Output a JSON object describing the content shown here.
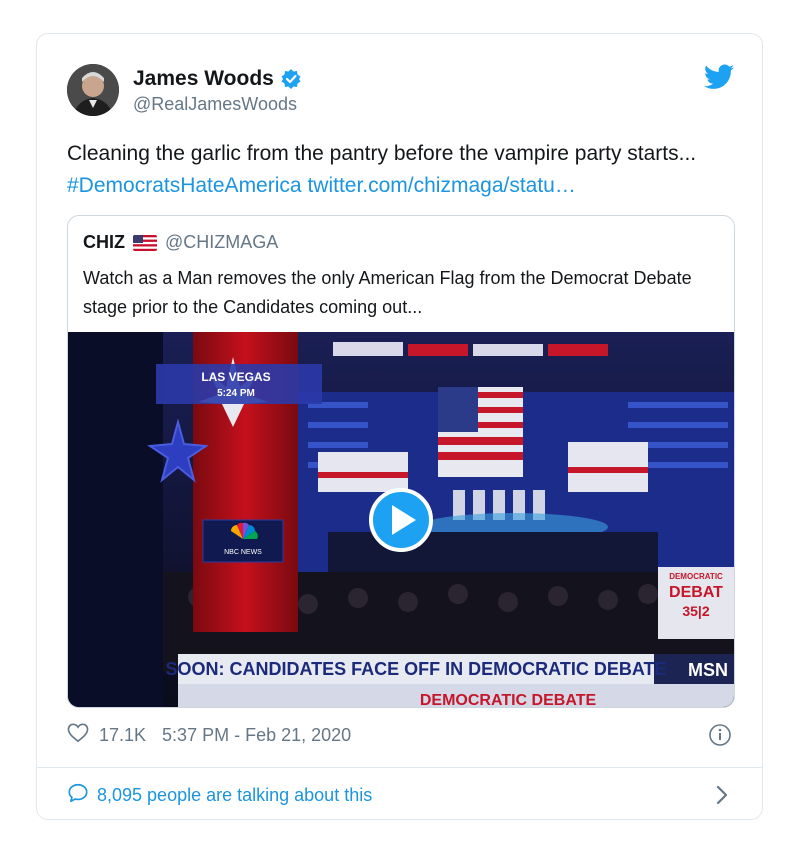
{
  "tweet": {
    "author_name": "James Woods",
    "author_handle": "@RealJamesWoods",
    "text_plain": "Cleaning the garlic from the pantry before the vampire party starts... ",
    "hashtag": "#DemocratsHateAmerica",
    "link": "twitter.com/chizmaga/statu…",
    "likes": "17.1K",
    "timestamp": "5:37 PM - Feb 21, 2020",
    "talking": "8,095 people are talking about this"
  },
  "quote": {
    "name": "CHIZ",
    "handle": "@CHIZMAGA",
    "text": "Watch as a Man removes the only American Flag from the Democrat Debate stage prior to the Candidates coming out..."
  },
  "video": {
    "location_label": "LAS VEGAS",
    "time_label": "5:24 PM",
    "network_label": "NBC NEWS",
    "ticker": "SOON: CANDIDATES FACE OFF IN DEMOCRATIC DEBATE",
    "ticker_sub": "DEMOCRATIC DEBATE",
    "side_label_1": "DEMOCRATIC",
    "side_label_2": "DEBAT",
    "side_label_3": "35|2",
    "channel": "MSN"
  },
  "icons": {
    "verified": "verified-badge-icon",
    "brand": "twitter-bird-icon",
    "like": "heart-icon",
    "info": "info-icon",
    "talk": "speech-bubble-icon",
    "chevron": "chevron-right-icon",
    "play": "play-icon"
  },
  "colors": {
    "link": "#1b95e0",
    "secondary_text": "#657786",
    "border": "#e1e8ed"
  }
}
